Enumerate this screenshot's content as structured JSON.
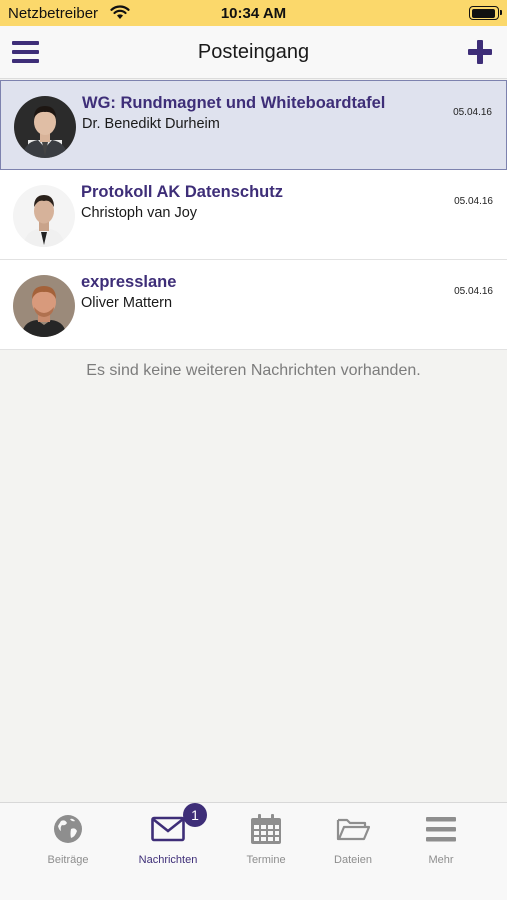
{
  "status_bar": {
    "carrier": "Netzbetreiber",
    "time": "10:34 AM"
  },
  "nav": {
    "title": "Posteingang"
  },
  "messages": [
    {
      "subject": "WG: Rundmagnet und Whiteboardtafel",
      "sender": "Dr. Benedikt Durheim",
      "date": "05.04.16",
      "selected": true
    },
    {
      "subject": "Protokoll AK Datenschutz",
      "sender": "Christoph van Joy",
      "date": "05.04.16",
      "selected": false
    },
    {
      "subject": "expresslane",
      "sender": "Oliver Mattern",
      "date": "05.04.16",
      "selected": false
    }
  ],
  "empty_note": "Es sind keine weiteren Nachrichten vorhanden.",
  "tabs": [
    {
      "label": "Beiträge",
      "icon": "globe-icon",
      "active": false
    },
    {
      "label": "Nachrichten",
      "icon": "envelope-icon",
      "active": true,
      "badge": "1"
    },
    {
      "label": "Termine",
      "icon": "calendar-icon",
      "active": false
    },
    {
      "label": "Dateien",
      "icon": "folder-icon",
      "active": false
    },
    {
      "label": "Mehr",
      "icon": "menu-icon",
      "active": false
    }
  ],
  "colors": {
    "accent": "#3e2e78",
    "status_bar": "#fbd86b",
    "selected_row": "#dfe2ee",
    "inactive_tab": "#8e8e8e"
  }
}
